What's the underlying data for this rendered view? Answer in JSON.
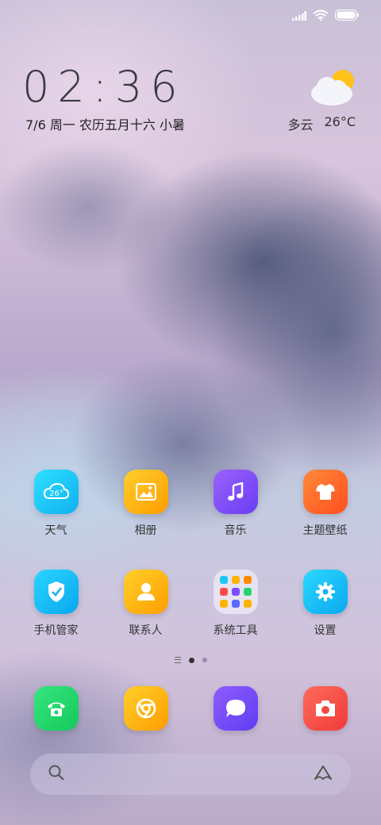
{
  "clock": {
    "time": "02:36"
  },
  "date": {
    "text": "7/6 周一 农历五月十六 小暑"
  },
  "weather": {
    "condition": "多云",
    "temperature": "26°C",
    "icon": "partly-cloudy-icon"
  },
  "apps_row1": [
    {
      "label": "天气",
      "icon": "weather-app-icon",
      "badge": "26°"
    },
    {
      "label": "相册",
      "icon": "gallery-icon"
    },
    {
      "label": "音乐",
      "icon": "music-icon"
    },
    {
      "label": "主题壁纸",
      "icon": "themes-icon"
    }
  ],
  "apps_row2": [
    {
      "label": "手机管家",
      "icon": "security-icon"
    },
    {
      "label": "联系人",
      "icon": "contacts-icon"
    },
    {
      "label": "系统工具",
      "icon": "folder-icon"
    },
    {
      "label": "设置",
      "icon": "settings-icon"
    }
  ],
  "dock": [
    {
      "icon": "phone-icon"
    },
    {
      "icon": "browser-icon"
    },
    {
      "icon": "messages-icon"
    },
    {
      "icon": "camera-icon"
    }
  ],
  "colors": {
    "weather": "#1ec8f5",
    "gallery": "#ffb300",
    "music": "#7b4dff",
    "themes": "#ff6a2b",
    "security": "#12b6f2",
    "contacts": "#ffb100",
    "settings": "#18b8f2",
    "phone": "#22d46a",
    "browser": "#ffb400",
    "messages": "#6f4df5",
    "camera": "#ff4b4b"
  },
  "search": {
    "search_icon": "search-icon",
    "assistant_icon": "assistant-icon"
  }
}
